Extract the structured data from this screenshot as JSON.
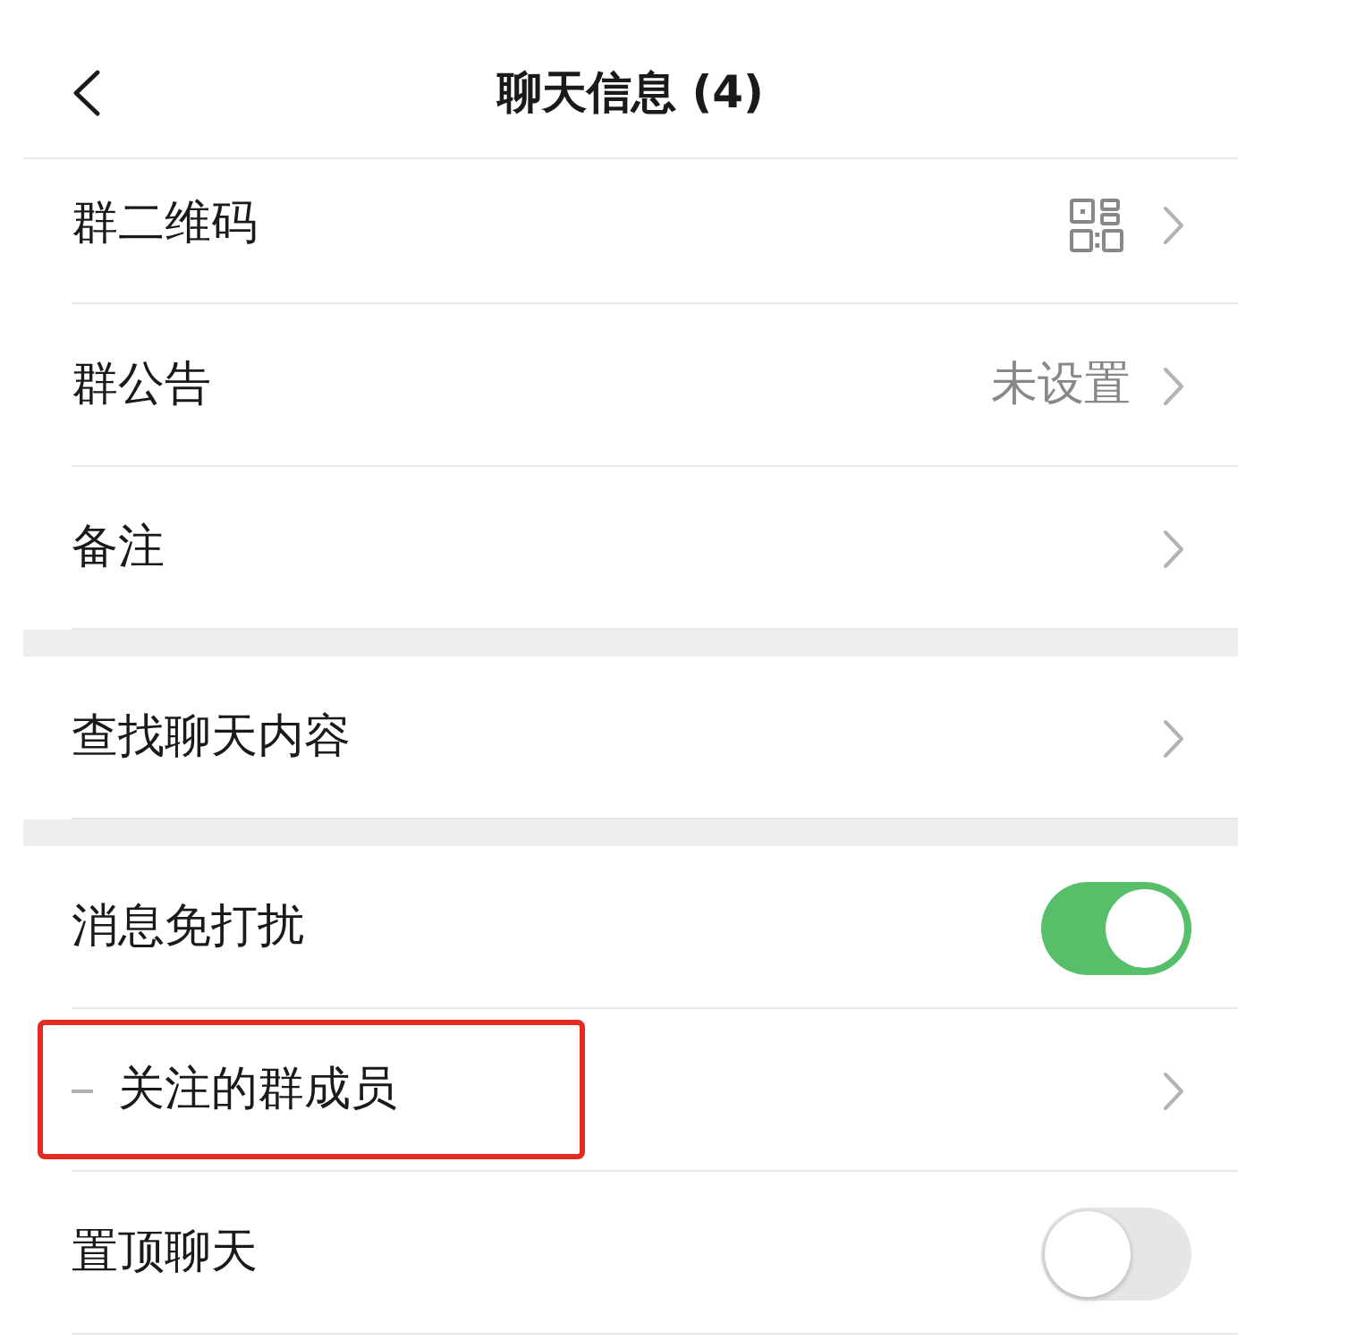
{
  "header": {
    "title": "聊天信息 (4)"
  },
  "sections": [
    {
      "items": [
        {
          "kind": "qrcode",
          "label": "群二维码",
          "leading_dash": false,
          "highlighted": false
        },
        {
          "kind": "link",
          "label": "群公告",
          "value": "未设置",
          "leading_dash": false,
          "highlighted": false
        },
        {
          "kind": "link",
          "label": "备注",
          "leading_dash": false,
          "highlighted": false
        }
      ]
    },
    {
      "items": [
        {
          "kind": "link",
          "label": "查找聊天内容",
          "leading_dash": false,
          "highlighted": false
        }
      ]
    },
    {
      "items": [
        {
          "kind": "toggle",
          "label": "消息免打扰",
          "on": true,
          "leading_dash": false,
          "highlighted": false
        },
        {
          "kind": "link",
          "label": "关注的群成员",
          "leading_dash": true,
          "highlighted": true
        },
        {
          "kind": "toggle",
          "label": "置顶聊天",
          "on": false,
          "leading_dash": false,
          "highlighted": false
        }
      ]
    }
  ]
}
